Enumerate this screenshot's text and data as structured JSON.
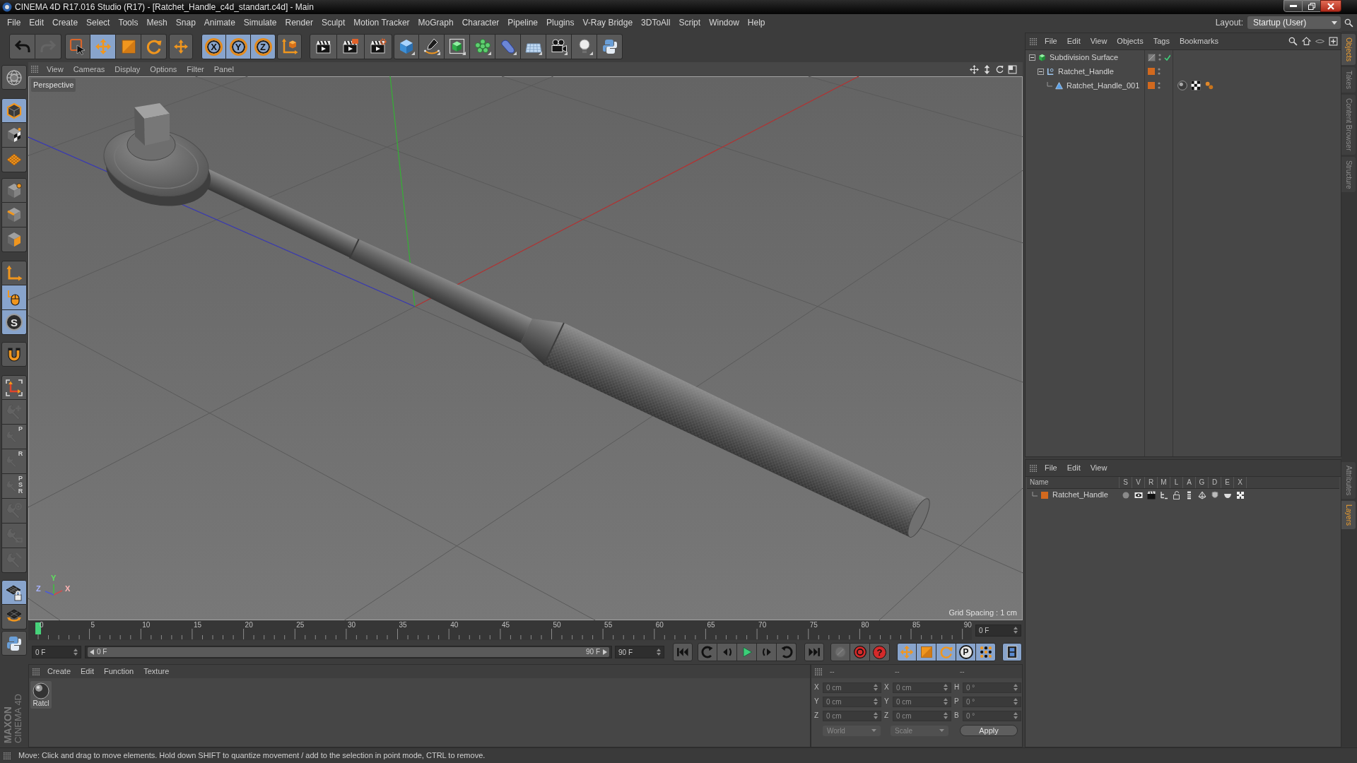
{
  "window": {
    "title": "CINEMA 4D R17.016 Studio (R17) - [Ratchet_Handle_c4d_standart.c4d] - Main"
  },
  "menu_bar": [
    "File",
    "Edit",
    "Create",
    "Select",
    "Tools",
    "Mesh",
    "Snap",
    "Animate",
    "Simulate",
    "Render",
    "Sculpt",
    "Motion Tracker",
    "MoGraph",
    "Character",
    "Pipeline",
    "Plugins",
    "V-Ray Bridge",
    "3DToAll",
    "Script",
    "Window",
    "Help"
  ],
  "layout": {
    "label": "Layout:",
    "value": "Startup (User)"
  },
  "toolbar": {
    "groups": [
      {
        "buttons": [
          {
            "selected": false,
            "disabled": false
          },
          {
            "selected": false,
            "disabled": true
          }
        ]
      },
      {
        "buttons": [
          {
            "selected": false,
            "disabled": false
          },
          {
            "selected": true,
            "disabled": false
          },
          {
            "selected": false,
            "disabled": false
          },
          {
            "selected": false,
            "disabled": false
          }
        ]
      },
      {
        "buttons": [
          {
            "selected": false,
            "disabled": false
          }
        ]
      },
      {
        "buttons": [
          {
            "label": "X",
            "selected": true,
            "disabled": false
          },
          {
            "label": "Y",
            "selected": true,
            "disabled": false
          },
          {
            "label": "Z",
            "selected": true,
            "disabled": false
          }
        ]
      },
      {
        "buttons": [
          {
            "selected": false,
            "disabled": false
          }
        ]
      },
      {
        "buttons": [
          {
            "selected": false,
            "disabled": false
          },
          {
            "selected": false,
            "disabled": false
          },
          {
            "selected": false,
            "disabled": false
          }
        ]
      },
      {
        "buttons": [
          {
            "selected": false,
            "disabled": false
          },
          {
            "selected": false,
            "disabled": false
          },
          {
            "selected": false,
            "disabled": false
          },
          {
            "selected": false,
            "disabled": false
          },
          {
            "selected": false,
            "disabled": false
          },
          {
            "selected": false,
            "disabled": false
          },
          {
            "selected": false,
            "disabled": false
          },
          {
            "selected": false,
            "disabled": false
          },
          {
            "selected": false,
            "disabled": false
          }
        ]
      }
    ]
  },
  "tool_palette": {
    "groups": [
      {
        "buttons": [
          {
            "selected": false,
            "disabled": false
          }
        ]
      },
      {
        "buttons": [
          {
            "selected": true,
            "disabled": false
          },
          {
            "selected": false,
            "disabled": false
          },
          {
            "selected": false,
            "disabled": false
          }
        ]
      },
      {
        "buttons": [
          {
            "selected": false,
            "disabled": false
          },
          {
            "selected": false,
            "disabled": false
          },
          {
            "selected": false,
            "disabled": false
          }
        ]
      },
      {
        "buttons": [
          {
            "selected": false,
            "disabled": false
          },
          {
            "selected": true,
            "disabled": false
          },
          {
            "label": "S",
            "selected": true,
            "disabled": false
          }
        ]
      },
      {
        "buttons": [
          {
            "selected": false,
            "disabled": false
          }
        ]
      },
      {
        "buttons": [
          {
            "selected": false,
            "disabled": false
          },
          {
            "selected": false,
            "disabled": true
          },
          {
            "label": "P",
            "selected": false,
            "disabled": true
          },
          {
            "label": "R",
            "selected": false,
            "disabled": true
          },
          {
            "label": "PSR",
            "selected": false,
            "disabled": true
          },
          {
            "selected": false,
            "disabled": true
          },
          {
            "selected": false,
            "disabled": true
          },
          {
            "selected": false,
            "disabled": true
          }
        ]
      },
      {
        "buttons": [
          {
            "selected": true,
            "disabled": false
          },
          {
            "selected": false,
            "disabled": false
          }
        ]
      },
      {
        "buttons": [
          {
            "selected": false,
            "disabled": false
          }
        ]
      }
    ]
  },
  "logo": {
    "line_1": "MAXON",
    "line_2": "CINEMA 4D"
  },
  "viewport": {
    "menu": [
      "View",
      "Cameras",
      "Display",
      "Options",
      "Filter",
      "Panel"
    ],
    "camera": "Perspective",
    "grid_spacing": "Grid Spacing : 1 cm",
    "gizmo": {
      "x": "X",
      "y": "Y",
      "z": "Z"
    }
  },
  "timeline": {
    "frame_labels": [
      "0",
      "5",
      "10",
      "15",
      "20",
      "25",
      "30",
      "35",
      "40",
      "45",
      "50",
      "55",
      "60",
      "65",
      "70",
      "75",
      "80",
      "85",
      "90"
    ],
    "playhead": {
      "level": 0
    },
    "current_frame": "0 F"
  },
  "playback": {
    "start_frame": "0 F",
    "range": {
      "start": "0 F",
      "end": "90 F",
      "level": 1
    },
    "end_frame": "90 F",
    "groups": [
      {
        "buttons": [
          {
            "selected": false,
            "disabled": false
          }
        ]
      },
      {
        "buttons": [
          {
            "selected": false,
            "disabled": false
          },
          {
            "selected": false,
            "disabled": false
          },
          {
            "selected": false,
            "disabled": false
          },
          {
            "selected": false,
            "disabled": false
          },
          {
            "selected": false,
            "disabled": false
          }
        ]
      },
      {
        "buttons": [
          {
            "selected": false,
            "disabled": false
          }
        ]
      },
      {
        "buttons": [
          {
            "selected": false,
            "disabled": true
          },
          {
            "selected": false,
            "disabled": false
          },
          {
            "label": "?",
            "selected": false,
            "disabled": false
          }
        ]
      },
      {
        "buttons": [
          {
            "selected": true,
            "disabled": false
          },
          {
            "selected": true,
            "disabled": false
          },
          {
            "selected": true,
            "disabled": false
          },
          {
            "label": "P",
            "selected": true,
            "disabled": false
          },
          {
            "selected": true,
            "disabled": false
          }
        ]
      },
      {
        "buttons": [
          {
            "selected": true,
            "disabled": false
          }
        ]
      }
    ]
  },
  "material_manager": {
    "menu": [
      "Create",
      "Edit",
      "Function",
      "Texture"
    ],
    "materials": [
      {
        "label": "Ratcl"
      }
    ]
  },
  "coordinates": {
    "columns": [
      "--",
      "--",
      "--"
    ],
    "rows": [
      {
        "cells": [
          {
            "axis": "X",
            "value": "0 cm"
          },
          {
            "axis": "X",
            "value": "0 cm"
          },
          {
            "axis": "H",
            "value": "0 °"
          }
        ]
      },
      {
        "cells": [
          {
            "axis": "Y",
            "value": "0 cm"
          },
          {
            "axis": "Y",
            "value": "0 cm"
          },
          {
            "axis": "P",
            "value": "0 °"
          }
        ]
      },
      {
        "cells": [
          {
            "axis": "Z",
            "value": "0 cm"
          },
          {
            "axis": "Z",
            "value": "0 cm"
          },
          {
            "axis": "B",
            "value": "0 °"
          }
        ]
      }
    ],
    "space": {
      "value": "World",
      "disabled": true
    },
    "mode": {
      "value": "Scale",
      "disabled": true
    },
    "apply": "Apply"
  },
  "object_manager": {
    "menu": [
      "File",
      "Edit",
      "View",
      "Objects",
      "Tags",
      "Bookmarks"
    ],
    "objects": [
      {
        "name": "Subdivision Surface",
        "kind": "generator",
        "expanded": true,
        "enabled": true,
        "children": [
          {
            "name": "Ratchet_Handle",
            "kind": "null",
            "color": "#d2691e",
            "expanded": true,
            "children": [
              {
                "name": "Ratchet_Handle_001",
                "kind": "polygon",
                "color": "#d2691e",
                "tags": [
                  {
                    "kind": "material"
                  },
                  {
                    "kind": "uvw"
                  },
                  {
                    "kind": "phong"
                  }
                ]
              }
            ]
          }
        ]
      }
    ]
  },
  "layer_manager": {
    "menu": [
      "File",
      "Edit",
      "View"
    ],
    "columns": [
      "Name",
      "S",
      "V",
      "R",
      "M",
      "L",
      "A",
      "G",
      "D",
      "E",
      "X"
    ],
    "layers": [
      {
        "name": "Ratchet_Handle",
        "color": "#d2691e"
      }
    ]
  },
  "side_tabs": {
    "upper": [
      {
        "label": "Objects",
        "selected": true
      },
      {
        "label": "Takes",
        "selected": false
      },
      {
        "label": "Content Browser",
        "selected": false
      },
      {
        "label": "Structure",
        "selected": false
      }
    ],
    "lower": [
      {
        "label": "Attributes",
        "selected": false
      },
      {
        "label": "Layers",
        "selected": true
      }
    ]
  },
  "status_bar": {
    "text": "Move: Click and drag to move elements. Hold down SHIFT to quantize movement / add to the selection in point mode, CTRL to remove."
  }
}
